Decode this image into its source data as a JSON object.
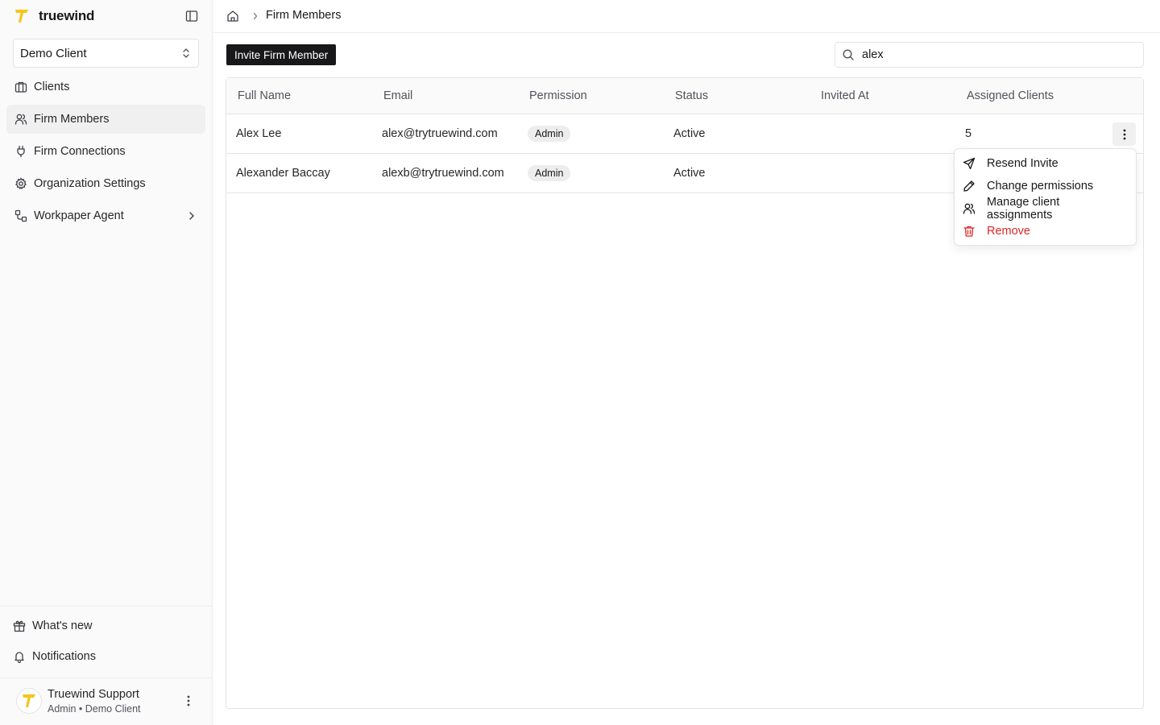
{
  "app": {
    "name": "truewind"
  },
  "sidebar": {
    "client_select": {
      "value": "Demo Client"
    },
    "items": [
      {
        "label": "Clients",
        "icon": "briefcase-icon",
        "active": false
      },
      {
        "label": "Firm Members",
        "icon": "users-icon",
        "active": true
      },
      {
        "label": "Firm Connections",
        "icon": "plug-icon",
        "active": false
      },
      {
        "label": "Organization Settings",
        "icon": "gear-icon",
        "active": false
      },
      {
        "label": "Workpaper Agent",
        "icon": "workflow-icon",
        "active": false
      }
    ],
    "footer": {
      "whats_new": "What's new",
      "notifications": "Notifications"
    },
    "user": {
      "name": "Truewind Support",
      "role": "Admin • Demo Client"
    }
  },
  "header": {
    "breadcrumb_current": "Firm Members"
  },
  "toolbar": {
    "invite_label": "Invite Firm Member",
    "search_value": "alex"
  },
  "table": {
    "columns": [
      "Full Name",
      "Email",
      "Permission",
      "Status",
      "Invited At",
      "Assigned Clients"
    ],
    "rows": [
      {
        "full_name": "Alex Lee",
        "email": "alex@trytruewind.com",
        "permission": "Admin",
        "status": "Active",
        "invited_at": "",
        "assigned_clients": "5"
      },
      {
        "full_name": "Alexander Baccay",
        "email": "alexb@trytruewind.com",
        "permission": "Admin",
        "status": "Active",
        "invited_at": "",
        "assigned_clients": ""
      }
    ]
  },
  "row_menu": {
    "items": [
      {
        "label": "Resend Invite",
        "icon": "send-icon"
      },
      {
        "label": "Change permissions",
        "icon": "pencil-icon"
      },
      {
        "label": "Manage client assignments",
        "icon": "users-icon"
      },
      {
        "label": "Remove",
        "icon": "trash-icon",
        "danger_color": "#dc2626"
      }
    ]
  },
  "colors": {
    "brand_yellow": "#f5c518",
    "primary_button": "#18181b",
    "danger": "#dc2626"
  }
}
